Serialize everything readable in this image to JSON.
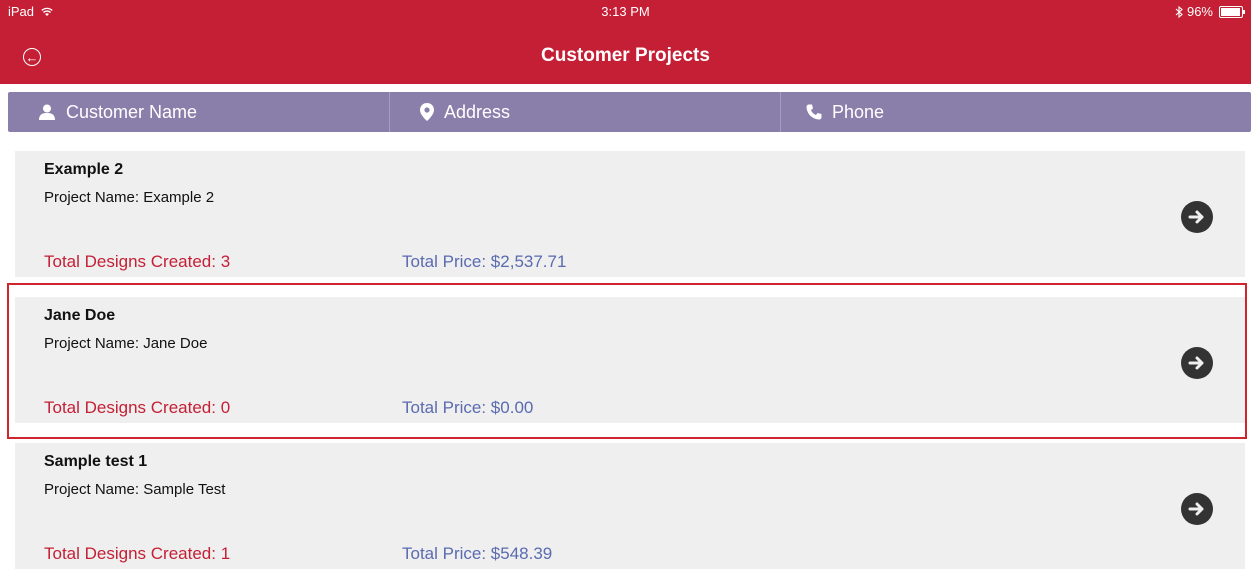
{
  "status": {
    "device": "iPad",
    "time": "3:13 PM",
    "battery": "96%"
  },
  "nav": {
    "title": "Customer Projects"
  },
  "columns": [
    {
      "label": "Customer Name",
      "icon": "person-icon"
    },
    {
      "label": "Address",
      "icon": "location-pin-icon"
    },
    {
      "label": "Phone",
      "icon": "phone-icon"
    }
  ],
  "projects": [
    {
      "customer": "Example 2",
      "project": "Project Name: Example 2",
      "designs": "Total Designs Created: 3",
      "price": "Total Price: $2,537.71"
    },
    {
      "customer": "Jane Doe",
      "project": "Project Name: Jane Doe",
      "designs": "Total Designs Created: 0",
      "price": "Total Price: $0.00",
      "highlighted": true
    },
    {
      "customer": "Sample test 1",
      "project": "Project Name: Sample Test",
      "designs": "Total Designs Created: 1",
      "price": "Total Price: $548.39"
    }
  ],
  "colors": {
    "nav_bar": "#c41f35",
    "header_bar": "#8a7fab",
    "designs_text": "#c41f35",
    "price_text": "#5a6bb0",
    "highlight_border": "#d0252d"
  }
}
